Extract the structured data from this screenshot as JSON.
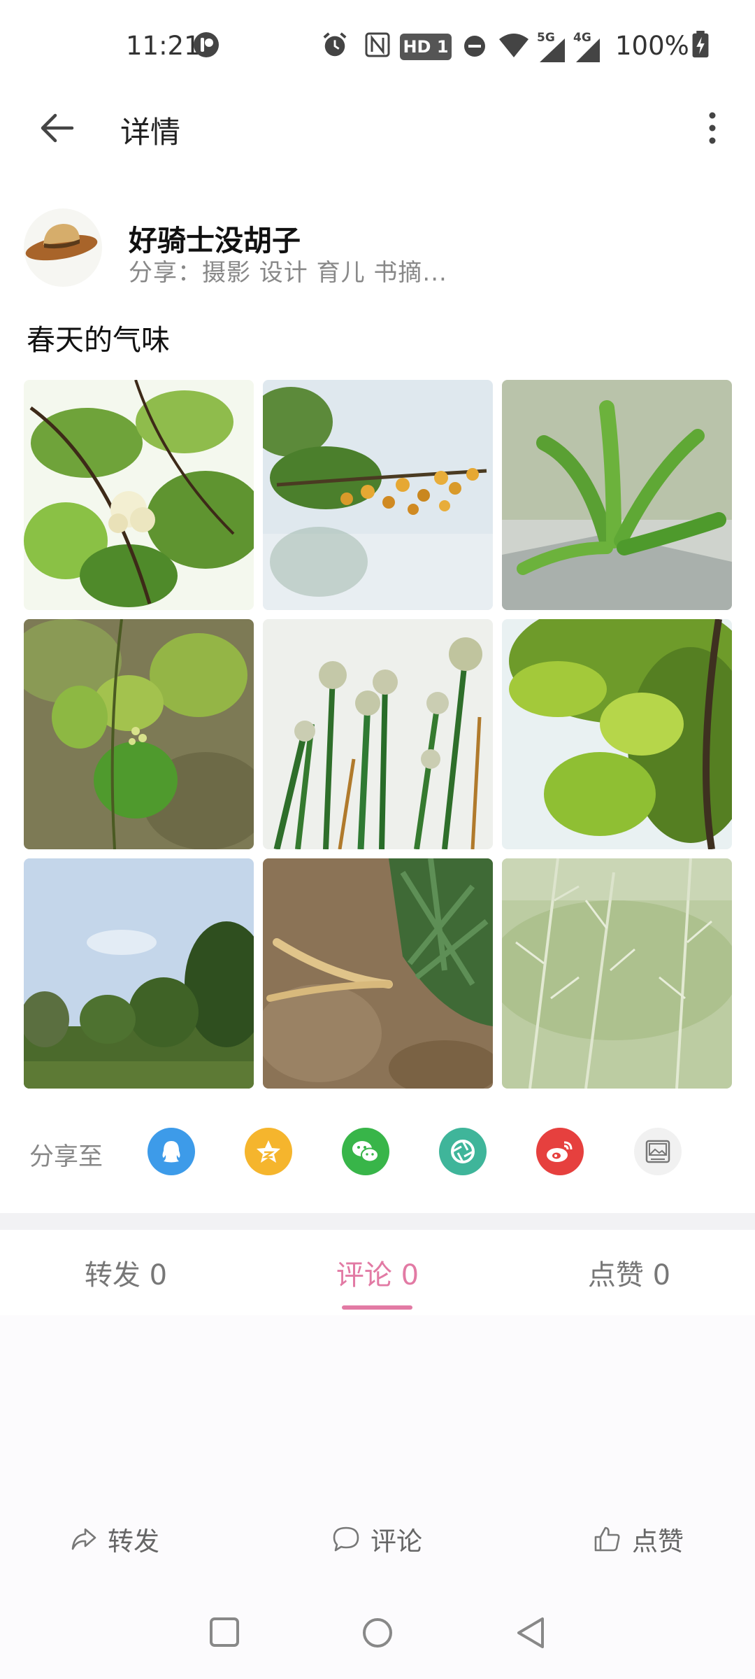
{
  "status_bar": {
    "time": "11:21",
    "hd_badge": "HD 1",
    "net_5g": "5G",
    "net_4g": "4G",
    "battery": "100%"
  },
  "header": {
    "title": "详情",
    "back_icon": "arrow-left-icon",
    "more_icon": "more-vertical-icon"
  },
  "author": {
    "name": "好骑士没胡子",
    "subtitle": "分享：摄影 设计 育儿 书摘...",
    "avatar_icon": "hat-avatar"
  },
  "post": {
    "text": "春天的气味",
    "images": [
      "photo-white-blossoms",
      "photo-orange-berries",
      "photo-green-seedling",
      "photo-grape-leaves",
      "photo-onion-flowers",
      "photo-tree-foliage",
      "photo-sky-trees",
      "photo-dug-root",
      "photo-rapeseed-pods"
    ]
  },
  "share": {
    "label": "分享至",
    "targets": [
      {
        "name": "qq-icon",
        "color": "#3d9be9"
      },
      {
        "name": "qzone-icon",
        "color": "#f5b52d"
      },
      {
        "name": "wechat-icon",
        "color": "#38b549"
      },
      {
        "name": "moments-icon",
        "color": "#3fb59a"
      },
      {
        "name": "weibo-icon",
        "color": "#e6403e"
      },
      {
        "name": "save-image-icon",
        "color": "#f1f1f1"
      }
    ]
  },
  "tabs": {
    "repost": "转发 0",
    "comments": "评论 0",
    "likes": "点赞 0",
    "active_color": "#e27aa4"
  },
  "actions": {
    "repost": "转发",
    "comment": "评论",
    "like": "点赞"
  }
}
